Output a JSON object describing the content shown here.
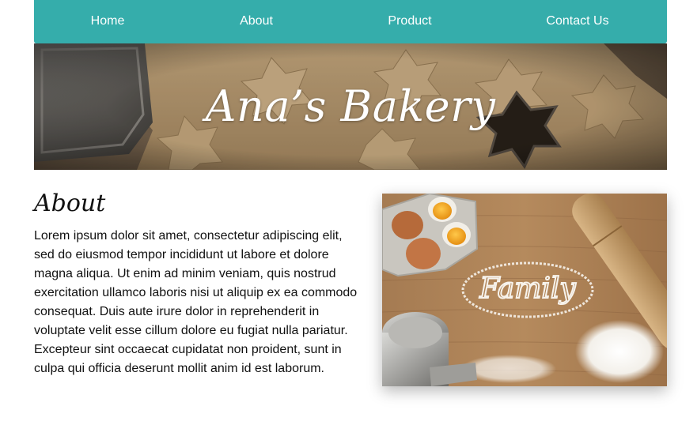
{
  "nav": {
    "items": [
      {
        "label": "Home"
      },
      {
        "label": "About"
      },
      {
        "label": "Product"
      },
      {
        "label": "Contact Us"
      }
    ]
  },
  "hero": {
    "title": "Ana’s Bakery"
  },
  "about": {
    "heading": "About",
    "body": "Lorem ipsum dolor sit amet, consectetur adipiscing elit, sed do eiusmod tempor incididunt ut labore et dolore magna aliqua. Ut enim ad minim veniam, quis nostrud exercitation ullamco laboris nisi ut aliquip ex ea commodo consequat. Duis aute irure dolor in reprehenderit in voluptate velit esse cillum dolore eu fugiat nulla pariatur. Excepteur sint occaecat cupidatat non proident, sunt in culpa qui officia deserunt mollit anim id est laborum."
  },
  "photo": {
    "flour_writing": "Family"
  },
  "colors": {
    "nav_background": "#35adab",
    "nav_text": "#ffffff",
    "hero_title": "#ffffff",
    "body_text": "#111111"
  }
}
